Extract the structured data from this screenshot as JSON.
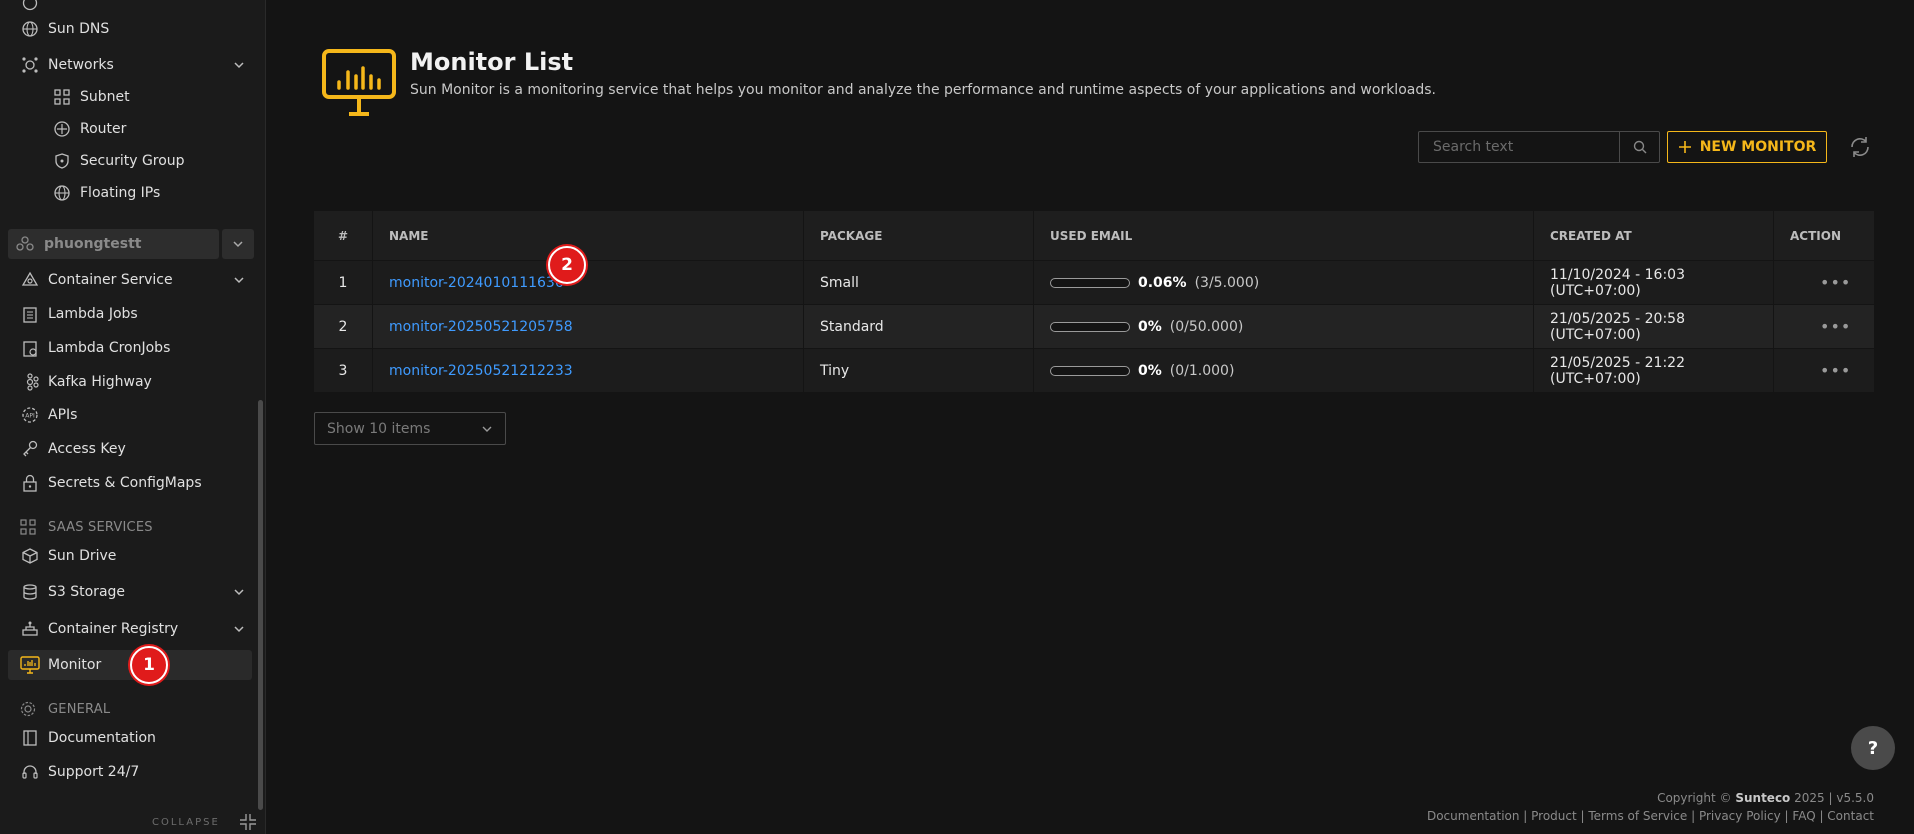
{
  "sidebar": {
    "items_top": [
      {
        "label": "Sun DNS",
        "icon": "globe-icon"
      },
      {
        "label": "Networks",
        "icon": "network-icon"
      }
    ],
    "network_subitems": [
      {
        "label": "Subnet",
        "icon": "subnet-icon"
      },
      {
        "label": "Router",
        "icon": "router-icon"
      },
      {
        "label": "Security Group",
        "icon": "shield-icon"
      },
      {
        "label": "Floating IPs",
        "icon": "globe-icon"
      }
    ],
    "project": "phuongtestt",
    "items_mid": [
      {
        "label": "Container Service",
        "icon": "container-icon"
      },
      {
        "label": "Lambda Jobs",
        "icon": "clipboard-icon"
      },
      {
        "label": "Lambda CronJobs",
        "icon": "clipboard-clock-icon"
      },
      {
        "label": "Kafka Highway",
        "icon": "kafka-icon"
      },
      {
        "label": "APIs",
        "icon": "api-icon"
      },
      {
        "label": "Access Key",
        "icon": "key-icon"
      },
      {
        "label": "Secrets & ConfigMaps",
        "icon": "lock-icon"
      }
    ],
    "section_saas": "SAAS SERVICES",
    "items_saas": [
      {
        "label": "Sun Drive",
        "icon": "box-icon"
      },
      {
        "label": "S3 Storage",
        "icon": "database-icon"
      },
      {
        "label": "Container Registry",
        "icon": "registry-icon"
      },
      {
        "label": "Monitor",
        "icon": "monitor-icon"
      }
    ],
    "section_general": "GENERAL",
    "items_general": [
      {
        "label": "Documentation",
        "icon": "book-icon"
      },
      {
        "label": "Support 24/7",
        "icon": "headset-icon"
      }
    ],
    "collapse_label": "COLLAPSE"
  },
  "badges": {
    "one": "1",
    "two": "2"
  },
  "header": {
    "title": "Monitor List",
    "subtitle": "Sun Monitor is a monitoring service that helps you monitor and analyze the performance and runtime aspects of your applications and workloads."
  },
  "toolbar": {
    "search_placeholder": "Search text",
    "new_button": "NEW MONITOR"
  },
  "table": {
    "headers": [
      "#",
      "NAME",
      "PACKAGE",
      "USED EMAIL",
      "CREATED AT",
      "ACTION"
    ],
    "rows": [
      {
        "no": "1",
        "name": "monitor-2024010111636",
        "package": "Small",
        "pct": "0.06%",
        "count": "(3/5.000)",
        "usage": 0.0006,
        "created": "11/10/2024 - 16:03 (UTC+07:00)",
        "action": "•••"
      },
      {
        "no": "2",
        "name": "monitor-20250521205758",
        "package": "Standard",
        "pct": "0%",
        "count": "(0/50.000)",
        "usage": 0,
        "created": "21/05/2025 - 20:58 (UTC+07:00)",
        "action": "•••"
      },
      {
        "no": "3",
        "name": "monitor-20250521212233",
        "package": "Tiny",
        "pct": "0%",
        "count": "(0/1.000)",
        "usage": 0,
        "created": "21/05/2025 - 21:22 (UTC+07:00)",
        "action": "•••"
      }
    ]
  },
  "pager": {
    "label": "Show 10 items"
  },
  "help_label": "?",
  "footer": {
    "copyright_prefix": "Copyright ©",
    "brand": "Sunteco",
    "copyright_suffix": "2025 | v5.5.0",
    "links": "Documentation | Product | Terms of Service | Privacy Policy | FAQ | Contact"
  },
  "colors": {
    "accent": "#f5b71a",
    "link": "#3f9bff",
    "badge": "#e01b1b"
  }
}
